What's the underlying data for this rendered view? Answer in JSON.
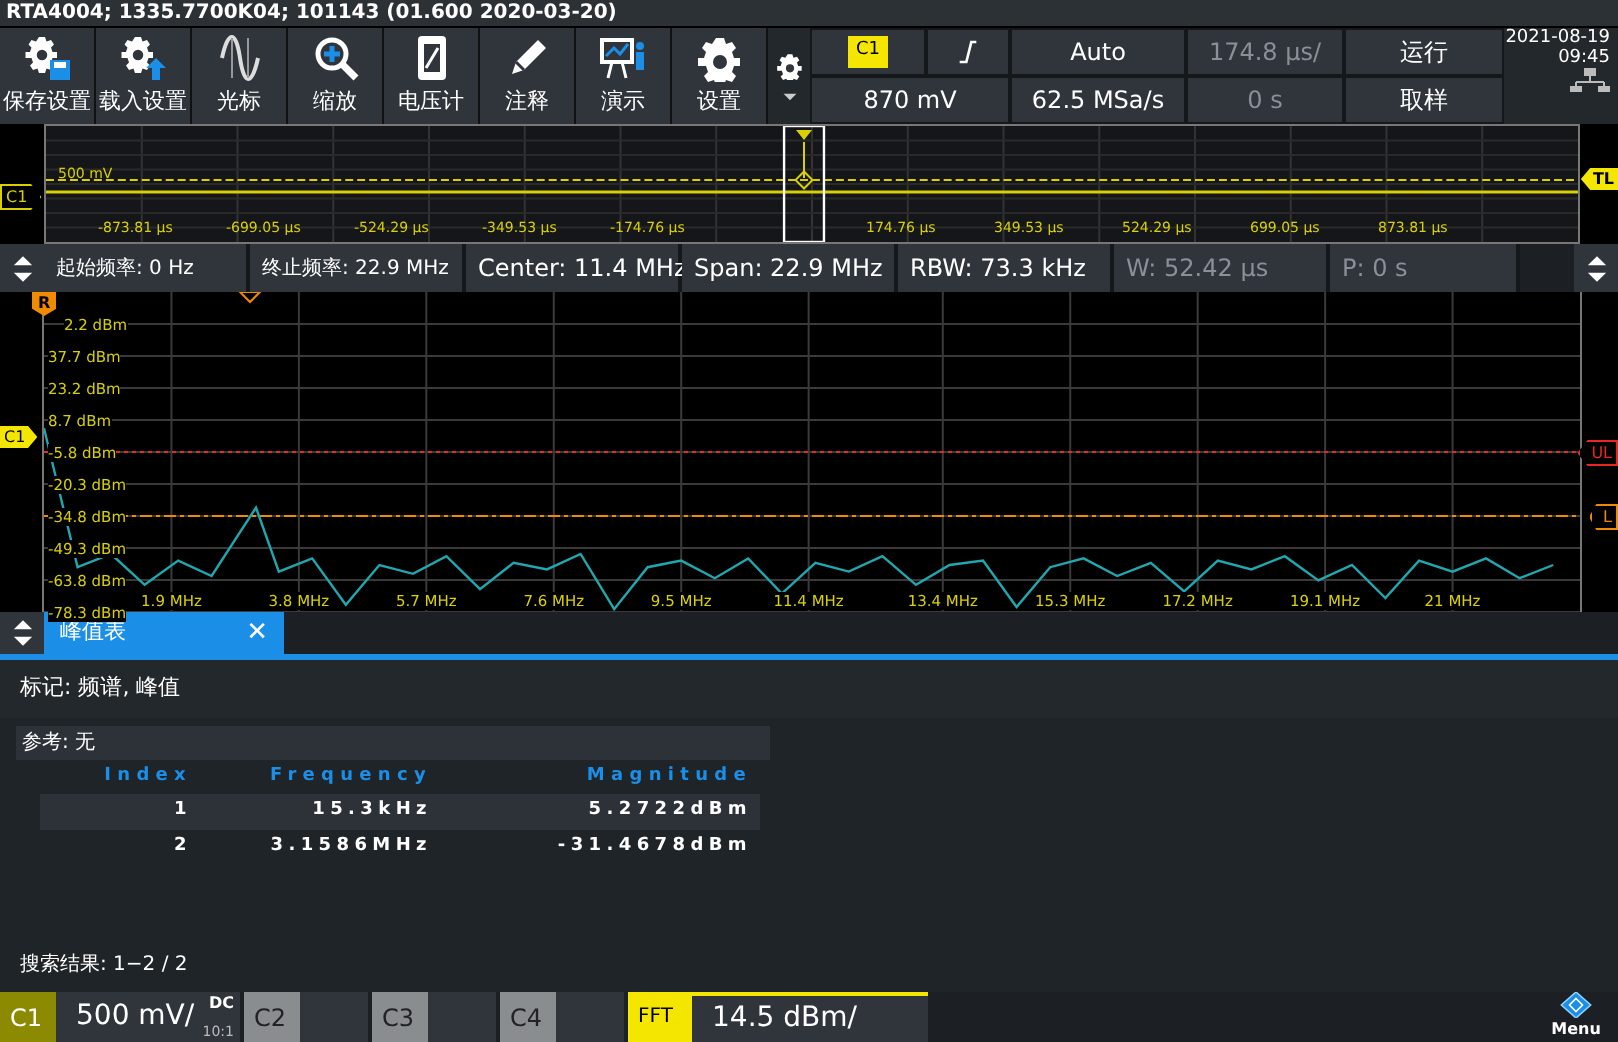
{
  "title_bar": {
    "text": "RTA4004; 1335.7700K04; 101143 (01.600 2020-03-20)"
  },
  "toolbar": [
    {
      "label": "保存设置",
      "kind": "save"
    },
    {
      "label": "载入设置",
      "kind": "load"
    },
    {
      "label": "光标",
      "kind": "cursor"
    },
    {
      "label": "缩放",
      "kind": "zoom"
    },
    {
      "label": "电压计",
      "kind": "meter"
    },
    {
      "label": "注释",
      "kind": "pencil"
    },
    {
      "label": "演示",
      "kind": "demo"
    },
    {
      "label": "设置",
      "kind": "gear"
    }
  ],
  "acquisition_panel": [
    {
      "kind": "badge",
      "text": "C1"
    },
    {
      "kind": "edge"
    },
    {
      "kind": "text",
      "text": "Auto",
      "disabled": false
    },
    {
      "kind": "text",
      "text": "174.8 µs/",
      "disabled": true
    },
    {
      "kind": "text",
      "text": "运行",
      "disabled": false
    },
    {
      "kind": "text",
      "text": "870 mV",
      "disabled": false
    },
    {
      "kind": "text",
      "text": "62.5 MSa/s",
      "disabled": false
    },
    {
      "kind": "text",
      "text": "0 s",
      "disabled": true
    },
    {
      "kind": "text",
      "text": "取样",
      "disabled": false
    }
  ],
  "clock": {
    "date": "2021-08-19",
    "time": "09:45"
  },
  "time_axis": {
    "level_label": "500 mV",
    "channel_marker": "C1",
    "trigger_marker": "TL",
    "labels": [
      "-873.81 µs",
      "-699.05 µs",
      "-524.29 µs",
      "-349.53 µs",
      "-174.76 µs",
      "174.76 µs",
      "349.53 µs",
      "524.29 µs",
      "699.05 µs",
      "873.81 µs"
    ]
  },
  "frequency_bar": [
    {
      "text": "起始频率: 0 Hz",
      "disabled": false
    },
    {
      "text": "终止频率: 22.9 MHz",
      "disabled": false
    },
    {
      "text": "Center: 11.4 MHz",
      "disabled": false
    },
    {
      "text": "Span: 22.9 MHz",
      "disabled": false
    },
    {
      "text": "RBW: 73.3 kHz",
      "disabled": false
    },
    {
      "text": "W: 52.42 µs",
      "disabled": true
    },
    {
      "text": "P: 0 s",
      "disabled": true
    }
  ],
  "spectrum": {
    "reference_marker": "R",
    "channel_marker": "C1",
    "covered_tick_label": "2.2 dBm",
    "chart_data": {
      "type": "line",
      "grid": true,
      "xlim": [
        0,
        22.9
      ],
      "ylim": [
        -78.3,
        66.7
      ],
      "ref_lines": [
        {
          "axis": "y",
          "value": -5.8,
          "label": "UL",
          "color": "#e8281e"
        },
        {
          "axis": "y",
          "value": -34.8,
          "label": "L",
          "color": "#f08a00"
        }
      ],
      "yticks": [
        {
          "value": 37.7,
          "label": "37.7 dBm"
        },
        {
          "value": 23.2,
          "label": "23.2 dBm"
        },
        {
          "value": 8.7,
          "label": "8.7 dBm"
        },
        {
          "value": -5.8,
          "label": "-5.8 dBm"
        },
        {
          "value": -20.3,
          "label": "-20.3 dBm"
        },
        {
          "value": -34.8,
          "label": "-34.8 dBm"
        },
        {
          "value": -49.3,
          "label": "-49.3 dBm"
        },
        {
          "value": -63.8,
          "label": "-63.8 dBm"
        },
        {
          "value": -78.3,
          "label": "-78.3 dBm"
        }
      ],
      "xticks": [
        {
          "value": 1.9,
          "label": "1.9 MHz"
        },
        {
          "value": 3.8,
          "label": "3.8 MHz"
        },
        {
          "value": 5.7,
          "label": "5.7 MHz"
        },
        {
          "value": 7.6,
          "label": "7.6 MHz"
        },
        {
          "value": 9.5,
          "label": "9.5 MHz"
        },
        {
          "value": 11.4,
          "label": "11.4 MHz"
        },
        {
          "value": 13.4,
          "label": "13.4 MHz"
        },
        {
          "value": 15.3,
          "label": "15.3 MHz"
        },
        {
          "value": 17.2,
          "label": "17.2 MHz"
        },
        {
          "value": 19.1,
          "label": "19.1 MHz"
        },
        {
          "value": 21,
          "label": "21 MHz"
        }
      ],
      "x": [
        0,
        0.5,
        1,
        1.5,
        2,
        2.5,
        3.16,
        3.5,
        4,
        4.5,
        5,
        5.5,
        6,
        6.5,
        7,
        7.5,
        8,
        8.5,
        9,
        9.5,
        10,
        10.5,
        11,
        11.5,
        12,
        12.5,
        13,
        13.5,
        14,
        14.5,
        15,
        15.5,
        16,
        16.5,
        17,
        17.5,
        18,
        18.5,
        19,
        19.5,
        20,
        20.5,
        21,
        21.5,
        22,
        22.5
      ],
      "values": [
        5,
        -58,
        -52,
        -66,
        -55,
        -62,
        -31,
        -60,
        -54,
        -75,
        -57,
        -61,
        -53,
        -68,
        -56,
        -59,
        -52,
        -77,
        -58,
        -55,
        -63,
        -54,
        -70,
        -56,
        -60,
        -53,
        -66,
        -57,
        -55,
        -76,
        -58,
        -54,
        -62,
        -56,
        -69,
        -55,
        -59,
        -53,
        -64,
        -57,
        -72,
        -55,
        -60,
        -54,
        -63,
        -57
      ]
    }
  },
  "tabs": [
    {
      "label": "峰值表",
      "selected": true,
      "close": "✕"
    }
  ],
  "results": {
    "marker_line": "标记: 频谱, 峰值",
    "reference": "参考: 无",
    "columns": [
      "Index",
      "Frequency",
      "Magnitude"
    ],
    "rows": [
      {
        "cells": [
          "1",
          "15.3kHz",
          "5.2722dBm"
        ]
      },
      {
        "cells": [
          "2",
          "3.1586MHz",
          "-31.4678dBm"
        ]
      }
    ],
    "search_result": "搜索结果: 1−2 / 2"
  },
  "channels": [
    {
      "label": "C1",
      "kind": "analog",
      "active": true,
      "value": "500 mV/",
      "coupling": "DC",
      "ratio": "10:1"
    },
    {
      "label": "C2",
      "kind": "analog",
      "active": false
    },
    {
      "label": "C3",
      "kind": "analog",
      "active": false
    },
    {
      "label": "C4",
      "kind": "analog",
      "active": false
    },
    {
      "label": "FFT",
      "kind": "math",
      "active": true,
      "value": "14.5 dBm/"
    }
  ],
  "menu_button": {
    "label": "Menu"
  }
}
